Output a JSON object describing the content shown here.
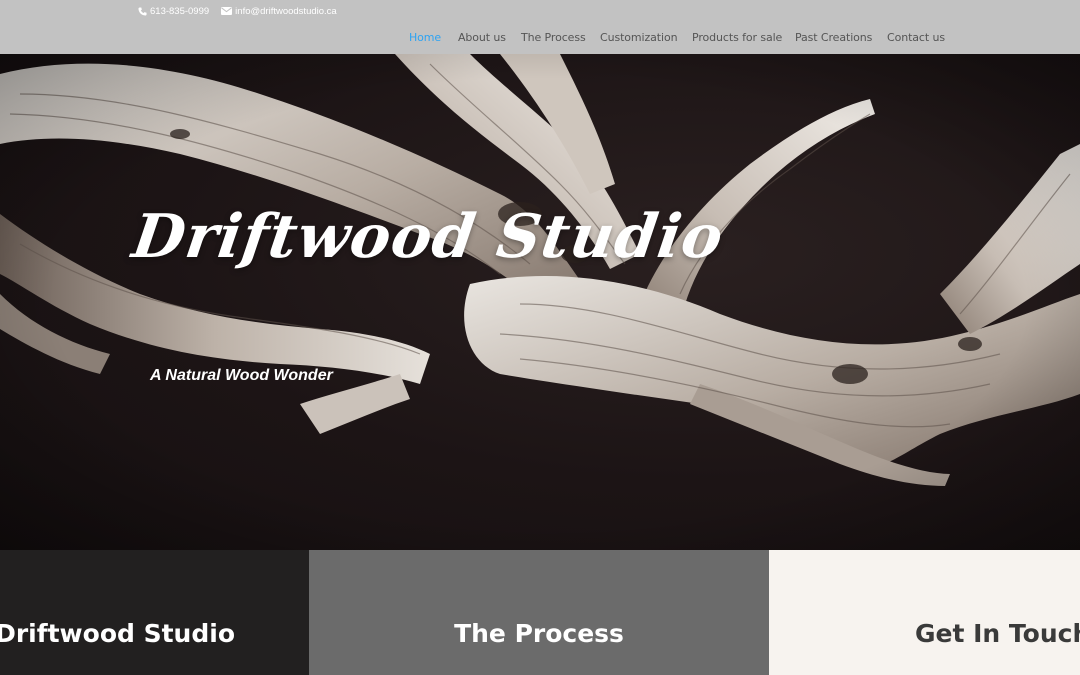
{
  "header": {
    "phone": "613-835-0999",
    "email": "info@driftwoodstudio.ca",
    "nav": [
      {
        "label": "Home",
        "active": true
      },
      {
        "label": "About us",
        "active": false
      },
      {
        "label": "The Process",
        "active": false
      },
      {
        "label": "Customization",
        "active": false
      },
      {
        "label": "Products for sale",
        "active": false
      },
      {
        "label": "Past Creations",
        "active": false
      },
      {
        "label": "Contact us",
        "active": false
      }
    ]
  },
  "hero": {
    "title": "Driftwood Studio",
    "subtitle": "A Natural Wood Wonder",
    "image": "driftwood-photo"
  },
  "panels": [
    {
      "title": "About Driftwood Studio"
    },
    {
      "title": "The Process"
    },
    {
      "title": "Get In Touch"
    }
  ],
  "colors": {
    "header_bg": "#c2c2c2",
    "nav_active": "#2ea3f2",
    "nav_text": "#555555",
    "hero_bg": "#1c1415",
    "panel_dark": "#222020",
    "panel_gray": "#6b6b6b",
    "panel_light": "#f7f3ef"
  }
}
